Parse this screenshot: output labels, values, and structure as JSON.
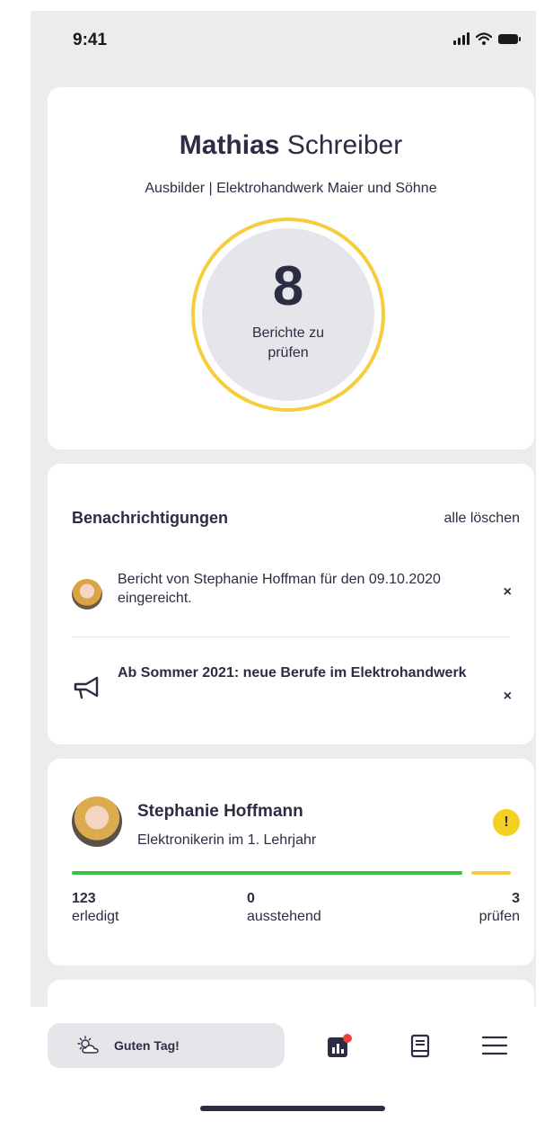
{
  "status_bar": {
    "time": "9:41"
  },
  "profile": {
    "first_name": "Mathias",
    "last_name": "Schreiber",
    "role": "Ausbilder | Elektrohandwerk Maier und Söhne",
    "report_count": "8",
    "report_label": "Berichte zu prüfen",
    "ring_color": "#f5cd3d"
  },
  "notifications": {
    "title": "Benachrichtigungen",
    "clear_all": "alle löschen",
    "items": [
      {
        "icon": "avatar",
        "text": "Bericht von Stephanie Hoffman für den 09.10.2020 eingereicht.",
        "close": "×"
      },
      {
        "icon": "megaphone-icon",
        "text": "Ab Sommer 2021: neue Berufe im Elektrohandwerk",
        "close": "×"
      }
    ]
  },
  "trainee": {
    "name": "Stephanie Hoffmann",
    "subtitle": "Elektronikerin im 1. Lehrjahr",
    "warning": "!",
    "stats": {
      "done_value": "123",
      "done_label": "erledigt",
      "pending_value": "0",
      "pending_label": "ausstehend",
      "review_value": "3",
      "review_label": "prüfen"
    },
    "colors": {
      "done": "#37c044",
      "review": "#f5cd3d",
      "warning": "#f5d022"
    }
  },
  "bottom_bar": {
    "greeting": "Guten Tag!",
    "greeting_icon": "weather-icon",
    "nav": [
      "chart-icon",
      "book-icon",
      "menu-icon"
    ],
    "notification_dot_color": "#f0403c"
  }
}
